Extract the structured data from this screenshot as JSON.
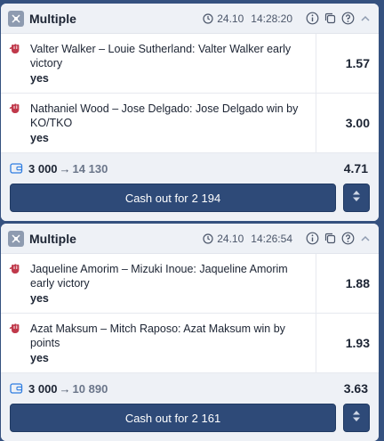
{
  "bets": [
    {
      "title": "Multiple",
      "date": "24.10",
      "time": "14:28:20",
      "selections": [
        {
          "event": "Valter Walker – Louie Sutherland: Valter Walker early victory",
          "pick": "yes",
          "odd": "1.57"
        },
        {
          "event": "Nathaniel Wood – Jose Delgado: Jose Delgado win by KO/TKO",
          "pick": "yes",
          "odd": "3.00"
        }
      ],
      "stake": "3 000",
      "arrow": "→",
      "payout": "14 130",
      "total_odd": "4.71",
      "cashout_label": "Cash out for",
      "cashout_amount": "2 194"
    },
    {
      "title": "Multiple",
      "date": "24.10",
      "time": "14:26:54",
      "selections": [
        {
          "event": "Jaqueline Amorim – Mizuki Inoue: Jaqueline Amorim early victory",
          "pick": "yes",
          "odd": "1.88"
        },
        {
          "event": "Azat Maksum – Mitch Raposo: Azat Maksum win by points",
          "pick": "yes",
          "odd": "1.93"
        }
      ],
      "stake": "3 000",
      "arrow": "→",
      "payout": "10 890",
      "total_odd": "3.63",
      "cashout_label": "Cash out for",
      "cashout_amount": "2 161"
    }
  ],
  "icons": {
    "header": "multiple-bet-icon",
    "date": "clock-icon",
    "info": "info-icon",
    "copy": "copy-icon",
    "help": "help-icon",
    "collapse": "chevron-up-icon",
    "sport": "mma-glove-icon",
    "wallet": "wallet-icon",
    "menu": "up-down-arrows-icon"
  },
  "colors": {
    "background": "#35517f",
    "button": "#2e4a78",
    "sport_icon": "#c0394b"
  }
}
